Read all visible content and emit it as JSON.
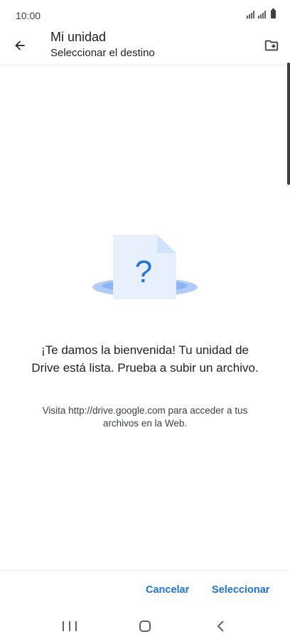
{
  "status_bar": {
    "time": "10:00"
  },
  "app_bar": {
    "title": "Mi unidad",
    "subtitle": "Seleccionar el destino"
  },
  "empty_state": {
    "headline": "¡Te damos la bienvenida! Tu unidad de Drive está lista. Prueba a subir un archivo.",
    "body": "Visita http://drive.google.com para acceder a tus archivos en la Web."
  },
  "actions": {
    "cancel_label": "Cancelar",
    "select_label": "Seleccionar"
  },
  "colors": {
    "accent": "#1a73e8",
    "illustration_light": "#e8f0fe",
    "illustration_mid": "#aecbfa"
  },
  "icons": [
    "back-arrow-icon",
    "new-folder-icon",
    "question-document-icon",
    "signal-icon",
    "battery-icon",
    "recent-apps-icon",
    "home-icon",
    "nav-back-icon"
  ]
}
